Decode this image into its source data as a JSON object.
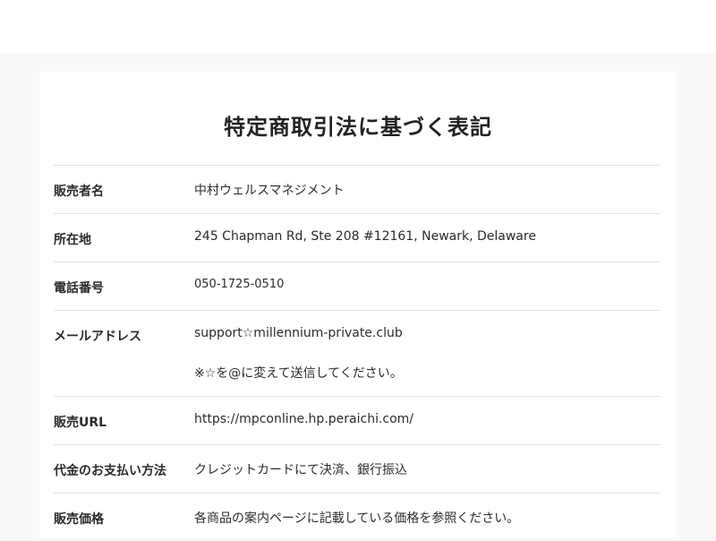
{
  "page": {
    "title": "特定商取引法に基づく表記"
  },
  "rows": [
    {
      "label": "販売者名",
      "value": "中村ウェルスマネジメント"
    },
    {
      "label": "所在地",
      "value": "245 Chapman Rd, Ste 208 #12161, Newark, Delaware"
    },
    {
      "label": "電話番号",
      "value": "050-1725-0510"
    },
    {
      "label": "メールアドレス",
      "value": "support☆millennium-private.club",
      "note": "※☆を@に変えて送信してください。"
    },
    {
      "label": "販売URL",
      "value": "https://mpconline.hp.peraichi.com/"
    },
    {
      "label": "代金のお支払い方法",
      "value": "クレジットカードにて決済、銀行振込"
    },
    {
      "label": "販売価格",
      "value": "各商品の案内ページに記載している価格を参照ください。"
    }
  ]
}
